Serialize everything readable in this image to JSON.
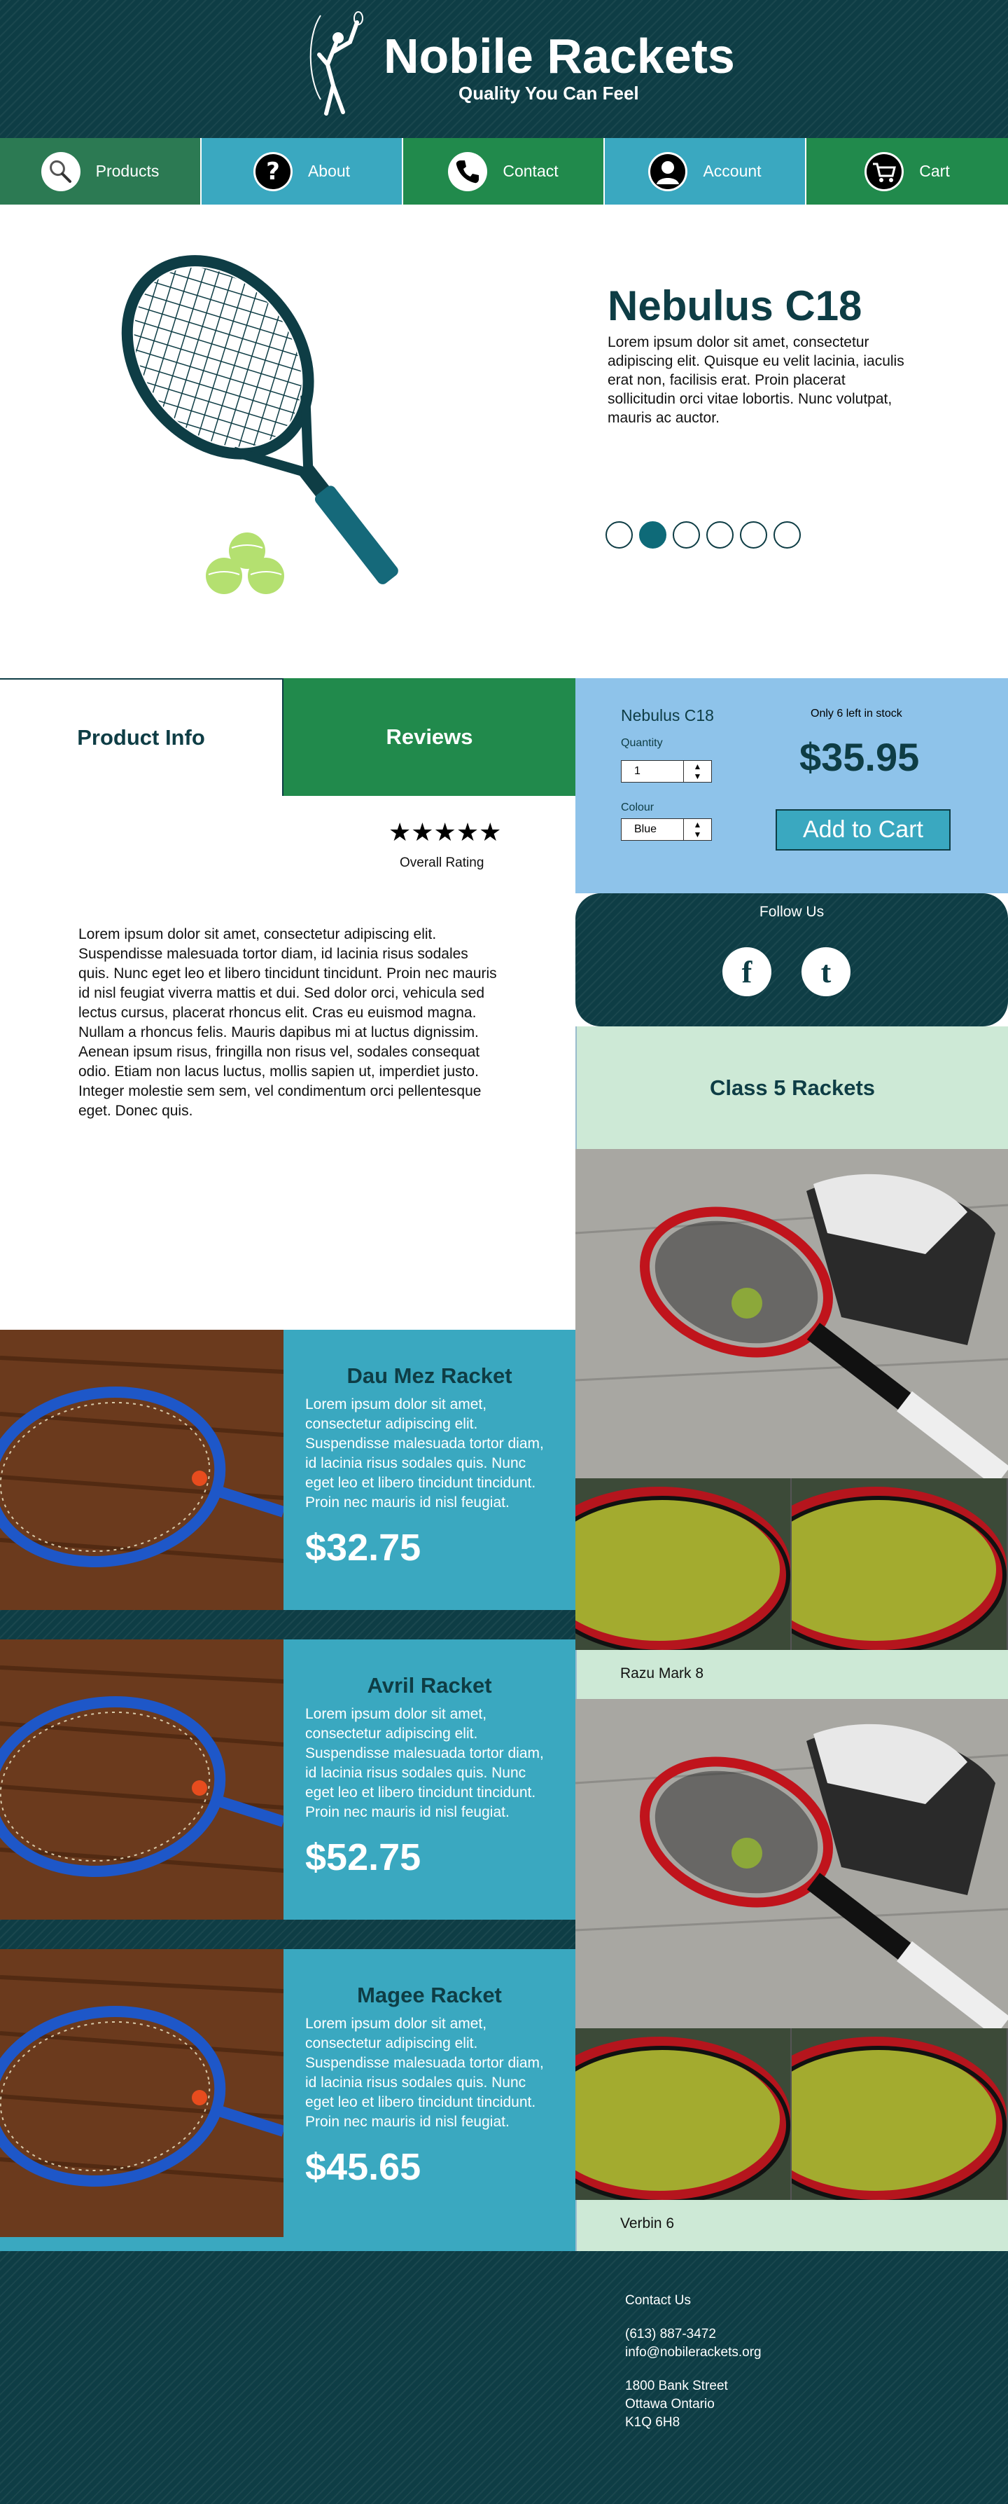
{
  "header": {
    "title": "Nobile Rackets",
    "tagline": "Quality You Can Feel",
    "logo_icon": "tennis-player-icon"
  },
  "nav": [
    {
      "label": "Products",
      "icon": "racket-icon"
    },
    {
      "label": "About",
      "icon": "question-icon"
    },
    {
      "label": "Contact",
      "icon": "phone-icon"
    },
    {
      "label": "Account",
      "icon": "user-icon"
    },
    {
      "label": "Cart",
      "icon": "cart-icon"
    }
  ],
  "hero": {
    "title": "Nebulus C18",
    "text": "Lorem ipsum dolor sit amet, consectetur adipiscing elit. Quisque eu velit lacinia, iaculis erat non, facilisis erat. Proin placerat sollicitudin orci vitae lobortis. Nunc volutpat, mauris ac auctor.",
    "slide_count": 6,
    "active_slide": 2
  },
  "tabs": {
    "product_info": "Product Info",
    "reviews": "Reviews"
  },
  "rating": {
    "stars": "★★★★★",
    "value": 5,
    "label": "Overall Rating"
  },
  "product_description": "Lorem ipsum dolor sit amet, consectetur adipiscing elit. Suspendisse malesuada tortor diam, id lacinia risus sodales quis. Nunc eget leo et libero tincidunt tincidunt. Proin nec mauris id nisl feugiat viverra mattis et dui. Sed dolor orci, vehicula sed lectus cursus, placerat rhoncus elit. Cras eu euismod magna. Nullam a rhoncus felis. Mauris dapibus mi at luctus dignissim. Aenean ipsum risus, fringilla non risus vel, sodales consequat odio. Etiam non lacus luctus, mollis sapien ut, imperdiet justo. Integer molestie sem sem, vel condimentum orci pellentesque eget. Donec quis.",
  "purchase": {
    "product_name": "Nebulus C18",
    "quantity_label": "Quantity",
    "quantity_value": "1",
    "colour_label": "Colour",
    "colour_value": "Blue",
    "stock": "Only 6 left in stock",
    "price": "$35.95",
    "add_to_cart": "Add to Cart"
  },
  "social": {
    "title": "Follow Us",
    "facebook": "f",
    "twitter": "t"
  },
  "sidebar": {
    "title": "Class 5 Rackets",
    "items": [
      {
        "name": "Razu Mark 8"
      },
      {
        "name": "Verbin 6"
      }
    ]
  },
  "products": [
    {
      "name": "Dau Mez Racket",
      "text": "Lorem ipsum dolor sit amet, consectetur adipiscing elit. Suspendisse malesuada tortor diam, id lacinia risus sodales quis. Nunc eget leo et libero tincidunt tincidunt. Proin nec mauris id nisl feugiat.",
      "price": "$32.75"
    },
    {
      "name": "Avril Racket",
      "text": "Lorem ipsum dolor sit amet, consectetur adipiscing elit. Suspendisse malesuada tortor diam, id lacinia risus sodales quis. Nunc eget leo et libero tincidunt tincidunt. Proin nec mauris id nisl feugiat.",
      "price": "$52.75"
    },
    {
      "name": "Magee Racket",
      "text": "Lorem ipsum dolor sit amet, consectetur adipiscing elit. Suspendisse malesuada tortor diam, id lacinia risus sodales quis. Nunc eget leo et libero tincidunt tincidunt. Proin nec mauris id nisl feugiat.",
      "price": "$45.65"
    }
  ],
  "footer": {
    "heading": "Contact Us",
    "phone": "(613) 887-3472",
    "email": "info@nobilerackets.org",
    "street": "1800 Bank Street",
    "city": "Ottawa Ontario",
    "postal": "K1Q 6H8"
  },
  "colors": {
    "dark_teal": "#0e3d45",
    "green": "#218a4c",
    "blue": "#3aa8c0",
    "light_blue": "#8ec3ea",
    "mint": "#cde9d6"
  }
}
